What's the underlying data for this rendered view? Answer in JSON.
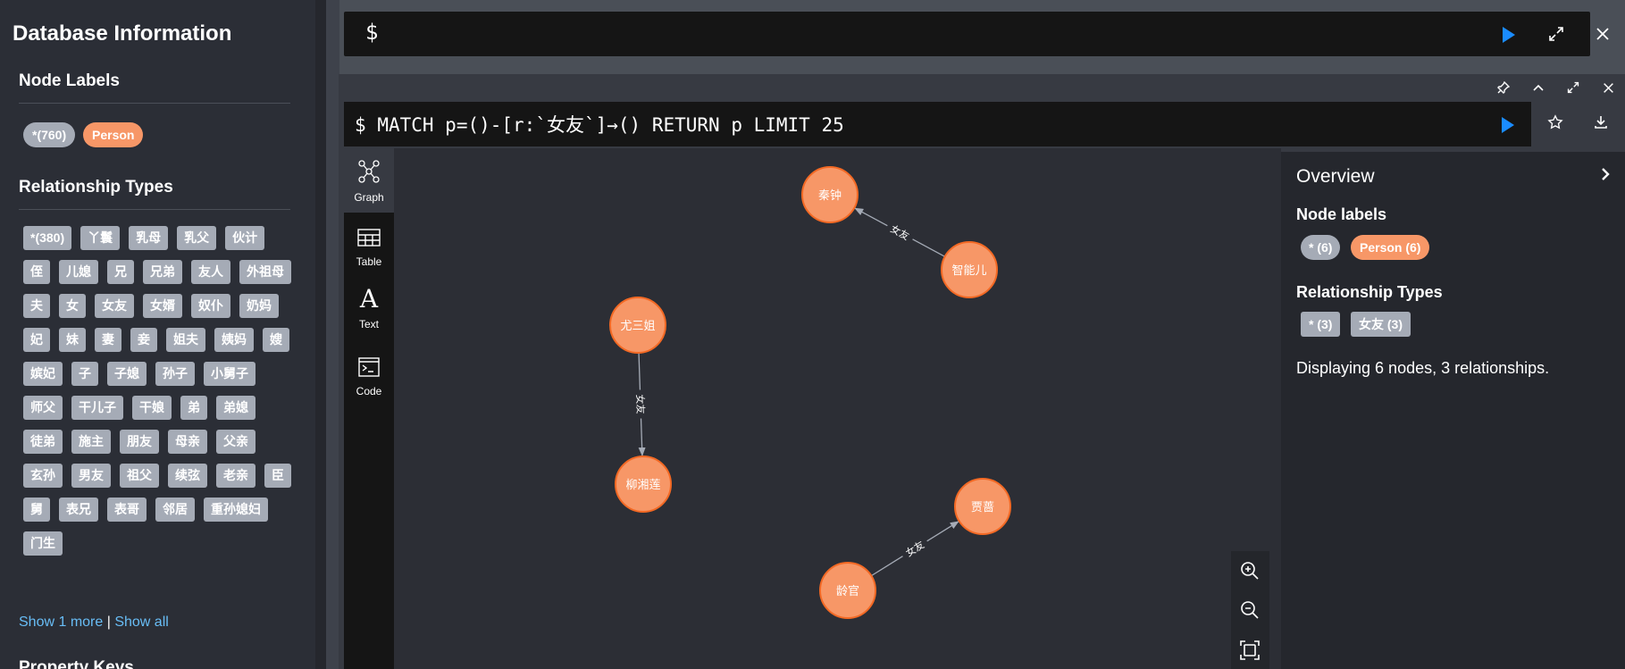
{
  "sidebar": {
    "title": "Database Information",
    "node_labels_heading": "Node Labels",
    "node_labels": [
      {
        "label": "*(760)",
        "color": "#a5abb6"
      },
      {
        "label": "Person",
        "color": "#f79767"
      }
    ],
    "relationship_types_heading": "Relationship Types",
    "relationship_types": [
      "*(380)",
      "丫鬟",
      "乳母",
      "乳父",
      "伙计",
      "侄",
      "儿媳",
      "兄",
      "兄弟",
      "友人",
      "外祖母",
      "夫",
      "女",
      "女友",
      "女婿",
      "奴仆",
      "奶妈",
      "妃",
      "妹",
      "妻",
      "妾",
      "姐夫",
      "姨妈",
      "嫂",
      "嫔妃",
      "子",
      "子媳",
      "孙子",
      "小舅子",
      "师父",
      "干儿子",
      "干娘",
      "弟",
      "弟媳",
      "徒弟",
      "施主",
      "朋友",
      "母亲",
      "父亲",
      "玄孙",
      "男友",
      "祖父",
      "续弦",
      "老亲",
      "臣",
      "舅",
      "表兄",
      "表哥",
      "邻居",
      "重孙媳妇",
      "门生"
    ],
    "show_more": "Show 1 more",
    "separator": "|",
    "show_all": "Show all",
    "property_keys_heading": "Property Keys"
  },
  "editor": {
    "prompt": "$",
    "run_icon": "play-icon",
    "expand_icon": "expand-icon",
    "close_icon": "close-icon"
  },
  "result": {
    "query": "MATCH p=()-[r:`女友`]→() RETURN p LIMIT 25",
    "prompt": "$",
    "tabs": [
      {
        "label": "Graph",
        "icon": "graph-icon",
        "active": true
      },
      {
        "label": "Table",
        "icon": "table-icon",
        "active": false
      },
      {
        "label": "Text",
        "icon": "text-icon",
        "active": false
      },
      {
        "label": "Code",
        "icon": "code-icon",
        "active": false
      }
    ],
    "frame_icons": [
      "pin-icon",
      "collapse-icon",
      "fullscreen-icon",
      "close-icon"
    ],
    "query_icons": [
      "play-icon",
      "star-icon",
      "download-icon"
    ]
  },
  "graph": {
    "nodes": [
      {
        "id": "qinzhong",
        "label": "秦钟"
      },
      {
        "id": "zhinenger",
        "label": "智能儿"
      },
      {
        "id": "yousanjie",
        "label": "尤三姐"
      },
      {
        "id": "liuxianglian",
        "label": "柳湘莲"
      },
      {
        "id": "jiaqiang",
        "label": "贾蔷"
      },
      {
        "id": "linguan",
        "label": "龄官"
      }
    ],
    "relationships": [
      {
        "from": "zhinenger",
        "to": "qinzhong",
        "type": "女友"
      },
      {
        "from": "yousanjie",
        "to": "liuxianglian",
        "type": "女友"
      },
      {
        "from": "linguan",
        "to": "jiaqiang",
        "type": "女友"
      }
    ],
    "node_color": "#f79767",
    "node_border": "#f36924",
    "zoom_icons": [
      "zoom-in-icon",
      "zoom-out-icon",
      "fit-icon"
    ]
  },
  "overview": {
    "title": "Overview",
    "node_labels_heading": "Node labels",
    "node_labels": [
      {
        "label": "* (6)",
        "color": "#a5abb6"
      },
      {
        "label": "Person (6)",
        "color": "#f79767"
      }
    ],
    "rel_types_heading": "Relationship Types",
    "rel_types": [
      {
        "label": "* (3)"
      },
      {
        "label": "女友 (3)"
      }
    ],
    "summary": "Displaying 6 nodes, 3 relationships."
  }
}
